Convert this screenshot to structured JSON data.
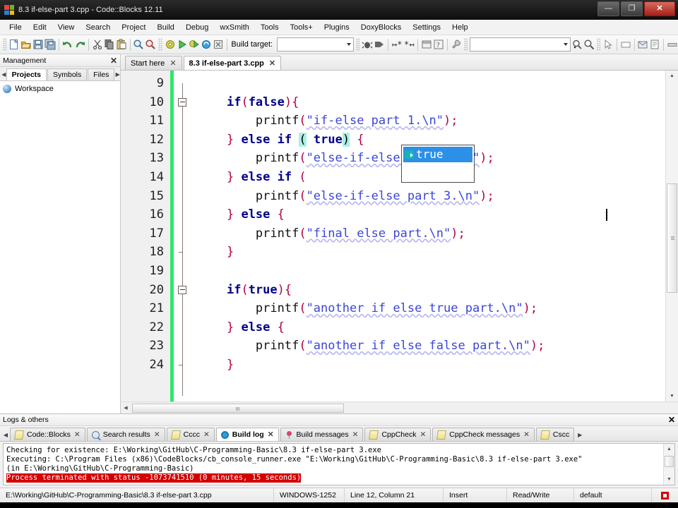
{
  "window": {
    "title": "8.3 if-else-part 3.cpp - Code::Blocks 12.11",
    "minimize_label": "—",
    "maximize_label": "❐",
    "close_label": "✕",
    "logo_icon": "codeblocks-logo-icon"
  },
  "menu": {
    "items": [
      {
        "label": "File"
      },
      {
        "label": "Edit"
      },
      {
        "label": "View"
      },
      {
        "label": "Search"
      },
      {
        "label": "Project"
      },
      {
        "label": "Build"
      },
      {
        "label": "Debug"
      },
      {
        "label": "wxSmith"
      },
      {
        "label": "Tools"
      },
      {
        "label": "Tools+"
      },
      {
        "label": "Plugins"
      },
      {
        "label": "DoxyBlocks"
      },
      {
        "label": "Settings"
      },
      {
        "label": "Help"
      }
    ]
  },
  "toolbar": {
    "build_target_label": "Build target:",
    "build_target_value": "",
    "search_value": "",
    "icons": [
      "new-file-icon",
      "open-file-icon",
      "save-icon",
      "save-all-icon",
      "undo-icon",
      "redo-icon",
      "cut-icon",
      "copy-icon",
      "paste-icon",
      "find-icon",
      "replace-icon",
      "build-icon",
      "run-icon",
      "build-and-run-icon",
      "rebuild-icon",
      "abort-icon",
      "debug-icon",
      "debug-step-icon",
      "next-line-icon",
      "step-into-icon",
      "debug-window-icon",
      "debug-info-icon",
      "various-icon",
      "find-declaration-icon",
      "find-implementation-icon",
      "select-pointer-icon",
      "dialog-icon",
      "mail-icon",
      "doc-icon",
      "bar-icon"
    ]
  },
  "management": {
    "title": "Management",
    "close_label": "✕",
    "prev_label": "◀",
    "next_label": "▶",
    "tabs": [
      {
        "label": "Projects",
        "active": true
      },
      {
        "label": "Symbols",
        "active": false
      },
      {
        "label": "Files",
        "active": false
      }
    ],
    "tree": {
      "workspace_label": "Workspace",
      "workspace_icon": "workspace-icon"
    }
  },
  "editor": {
    "tabs": [
      {
        "label": "Start here",
        "active": false,
        "close_label": "✕"
      },
      {
        "label": "8.3 if-else-part 3.cpp",
        "active": true,
        "close_label": "✕"
      }
    ],
    "first_line_number": 9,
    "lines": [
      {
        "num": 9,
        "fold": "none",
        "tokens": []
      },
      {
        "num": 10,
        "fold": "open",
        "tokens": [
          {
            "t": "    ",
            "c": "blk"
          },
          {
            "t": "if",
            "c": "kw"
          },
          {
            "t": "(",
            "c": "punct"
          },
          {
            "t": "false",
            "c": "kw"
          },
          {
            "t": ")",
            "c": "punct"
          },
          {
            "t": "{",
            "c": "punct"
          }
        ]
      },
      {
        "num": 11,
        "fold": "bar",
        "tokens": [
          {
            "t": "        ",
            "c": "blk"
          },
          {
            "t": "printf",
            "c": "fn"
          },
          {
            "t": "(",
            "c": "punct"
          },
          {
            "t": "\"if-else part 1.\\n\"",
            "c": "str"
          },
          {
            "t": ")",
            "c": "punct"
          },
          {
            "t": ";",
            "c": "punct"
          }
        ]
      },
      {
        "num": 12,
        "fold": "bar",
        "tokens": [
          {
            "t": "    ",
            "c": "blk"
          },
          {
            "t": "}",
            "c": "punct"
          },
          {
            "t": " ",
            "c": "blk"
          },
          {
            "t": "else",
            "c": "kw"
          },
          {
            "t": " ",
            "c": "blk"
          },
          {
            "t": "if",
            "c": "kw"
          },
          {
            "t": " ",
            "c": "blk"
          },
          {
            "t": "(",
            "c": "pmatch"
          },
          {
            "t": " ",
            "c": "blk"
          },
          {
            "t": "true",
            "c": "kw"
          },
          {
            "t": ")",
            "c": "pmatch"
          },
          {
            "t": " ",
            "c": "blk"
          },
          {
            "t": "{",
            "c": "punct"
          }
        ]
      },
      {
        "num": 13,
        "fold": "bar",
        "tokens": [
          {
            "t": "        ",
            "c": "blk"
          },
          {
            "t": "printf",
            "c": "fn"
          },
          {
            "t": "(",
            "c": "punct"
          },
          {
            "t": "\"else-if-else part 2.\\n\"",
            "c": "str"
          },
          {
            "t": ")",
            "c": "punct"
          },
          {
            "t": ";",
            "c": "punct"
          }
        ]
      },
      {
        "num": 14,
        "fold": "bar",
        "tokens": [
          {
            "t": "    ",
            "c": "blk"
          },
          {
            "t": "}",
            "c": "punct"
          },
          {
            "t": " ",
            "c": "blk"
          },
          {
            "t": "else",
            "c": "kw"
          },
          {
            "t": " ",
            "c": "blk"
          },
          {
            "t": "if",
            "c": "kw"
          },
          {
            "t": " ",
            "c": "blk"
          },
          {
            "t": "(",
            "c": "punct"
          }
        ]
      },
      {
        "num": 15,
        "fold": "bar",
        "tokens": [
          {
            "t": "        ",
            "c": "blk"
          },
          {
            "t": "printf",
            "c": "fn"
          },
          {
            "t": "(",
            "c": "punct"
          },
          {
            "t": "\"else-if-else part 3.\\n\"",
            "c": "str"
          },
          {
            "t": ")",
            "c": "punct"
          },
          {
            "t": ";",
            "c": "punct"
          }
        ]
      },
      {
        "num": 16,
        "fold": "bar",
        "tokens": [
          {
            "t": "    ",
            "c": "blk"
          },
          {
            "t": "}",
            "c": "punct"
          },
          {
            "t": " ",
            "c": "blk"
          },
          {
            "t": "else",
            "c": "kw"
          },
          {
            "t": " ",
            "c": "blk"
          },
          {
            "t": "{",
            "c": "punct"
          }
        ]
      },
      {
        "num": 17,
        "fold": "bar",
        "tokens": [
          {
            "t": "        ",
            "c": "blk"
          },
          {
            "t": "printf",
            "c": "fn"
          },
          {
            "t": "(",
            "c": "punct"
          },
          {
            "t": "\"final else part.\\n\"",
            "c": "str"
          },
          {
            "t": ")",
            "c": "punct"
          },
          {
            "t": ";",
            "c": "punct"
          }
        ]
      },
      {
        "num": 18,
        "fold": "end",
        "tokens": [
          {
            "t": "    ",
            "c": "blk"
          },
          {
            "t": "}",
            "c": "punct"
          }
        ]
      },
      {
        "num": 19,
        "fold": "none",
        "tokens": []
      },
      {
        "num": 20,
        "fold": "open",
        "tokens": [
          {
            "t": "    ",
            "c": "blk"
          },
          {
            "t": "if",
            "c": "kw"
          },
          {
            "t": "(",
            "c": "punct"
          },
          {
            "t": "true",
            "c": "kw"
          },
          {
            "t": ")",
            "c": "punct"
          },
          {
            "t": "{",
            "c": "punct"
          }
        ]
      },
      {
        "num": 21,
        "fold": "bar",
        "tokens": [
          {
            "t": "        ",
            "c": "blk"
          },
          {
            "t": "printf",
            "c": "fn"
          },
          {
            "t": "(",
            "c": "punct"
          },
          {
            "t": "\"another if else true part.\\n\"",
            "c": "str"
          },
          {
            "t": ")",
            "c": "punct"
          },
          {
            "t": ";",
            "c": "punct"
          }
        ]
      },
      {
        "num": 22,
        "fold": "bar",
        "tokens": [
          {
            "t": "    ",
            "c": "blk"
          },
          {
            "t": "}",
            "c": "punct"
          },
          {
            "t": " ",
            "c": "blk"
          },
          {
            "t": "else",
            "c": "kw"
          },
          {
            "t": " ",
            "c": "blk"
          },
          {
            "t": "{",
            "c": "punct"
          }
        ]
      },
      {
        "num": 23,
        "fold": "bar",
        "tokens": [
          {
            "t": "        ",
            "c": "blk"
          },
          {
            "t": "printf",
            "c": "fn"
          },
          {
            "t": "(",
            "c": "punct"
          },
          {
            "t": "\"another if else false part.\\n\"",
            "c": "str"
          },
          {
            "t": ")",
            "c": "punct"
          },
          {
            "t": ";",
            "c": "punct"
          }
        ]
      },
      {
        "num": 24,
        "fold": "end",
        "tokens": [
          {
            "t": "    ",
            "c": "blk"
          },
          {
            "t": "}",
            "c": "punct"
          }
        ]
      }
    ],
    "autocomplete": {
      "selected": "true",
      "icon": "keyword-suggestion-icon"
    },
    "change_marker_color": "#2ee86a",
    "scroll": {
      "up_label": "▲",
      "down_label": "▼",
      "left_label": "◀",
      "right_label": "▶"
    }
  },
  "logs": {
    "title": "Logs & others",
    "close_label": "✕",
    "prev_label": "◀",
    "next_label": "▶",
    "tabs": [
      {
        "label": "Code::Blocks",
        "icon": "note-icon",
        "active": false,
        "close_label": "✕"
      },
      {
        "label": "Search results",
        "icon": "search-icon",
        "active": false,
        "close_label": "✕"
      },
      {
        "label": "Cccc",
        "icon": "note-icon",
        "active": false,
        "close_label": "✕"
      },
      {
        "label": "Build log",
        "icon": "gear-icon",
        "active": true,
        "close_label": "✕"
      },
      {
        "label": "Build messages",
        "icon": "pin-icon",
        "active": false,
        "close_label": "✕"
      },
      {
        "label": "CppCheck",
        "icon": "note-icon",
        "active": false,
        "close_label": "✕"
      },
      {
        "label": "CppCheck messages",
        "icon": "note-icon",
        "active": false,
        "close_label": "✕"
      },
      {
        "label": "Cscc",
        "icon": "note-icon",
        "active": false,
        "close_label": "✕"
      }
    ],
    "build_log": {
      "line1": "Checking for existence: E:\\Working\\GitHub\\C-Programming-Basic\\8.3 if-else-part 3.exe",
      "line2": "Executing: C:\\Program Files (x86)\\CodeBlocks/cb_console_runner.exe \"E:\\Working\\GitHub\\C-Programming-Basic\\8.3 if-else-part 3.exe\"",
      "line3": "(in E:\\Working\\GitHub\\C-Programming-Basic)",
      "line4_error": "Process terminated with status -1073741510 (0 minutes, 15 seconds)",
      "error_bg": "#d40000"
    }
  },
  "statusbar": {
    "path": "E:\\Working\\GitHub\\C-Programming-Basic\\8.3 if-else-part 3.cpp",
    "encoding": "WINDOWS-1252",
    "position": "Line 12, Column 21",
    "insert_mode": "Insert",
    "blank": "",
    "access": "Read/Write",
    "profile": "default",
    "indicator_icon": "modified-indicator-icon"
  }
}
